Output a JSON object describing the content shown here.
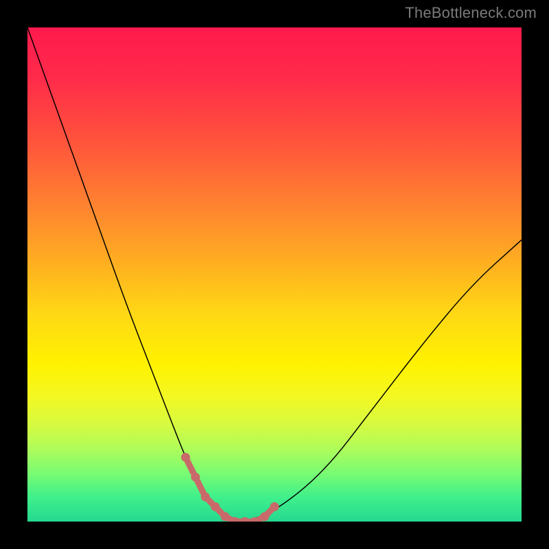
{
  "watermark": "TheBottleneck.com",
  "colors": {
    "background": "#000000",
    "gradient_top": "#ff1a4d",
    "gradient_mid": "#fff200",
    "gradient_bottom": "#25d890",
    "curve": "#000000",
    "marker": "#c96a6a"
  },
  "chart_data": {
    "type": "line",
    "title": "",
    "xlabel": "",
    "ylabel": "",
    "xlim": [
      0,
      100
    ],
    "ylim": [
      0,
      100
    ],
    "x": [
      0,
      5,
      10,
      15,
      20,
      25,
      30,
      32,
      34,
      36,
      38,
      40,
      42,
      44,
      50,
      60,
      70,
      80,
      90,
      100
    ],
    "series": [
      {
        "name": "bottleneck-curve",
        "values": [
          100,
          86,
          72,
          58,
          44,
          31,
          18,
          13,
          9,
          5,
          3,
          1,
          0,
          0,
          2,
          10,
          23,
          36,
          48,
          57
        ]
      }
    ],
    "markers": {
      "name": "highlighted-range",
      "x": [
        32,
        34,
        36,
        38,
        40,
        42,
        44,
        46,
        48,
        50
      ],
      "y": [
        13,
        9,
        5,
        3,
        1,
        0,
        0,
        0,
        1,
        3
      ]
    }
  }
}
